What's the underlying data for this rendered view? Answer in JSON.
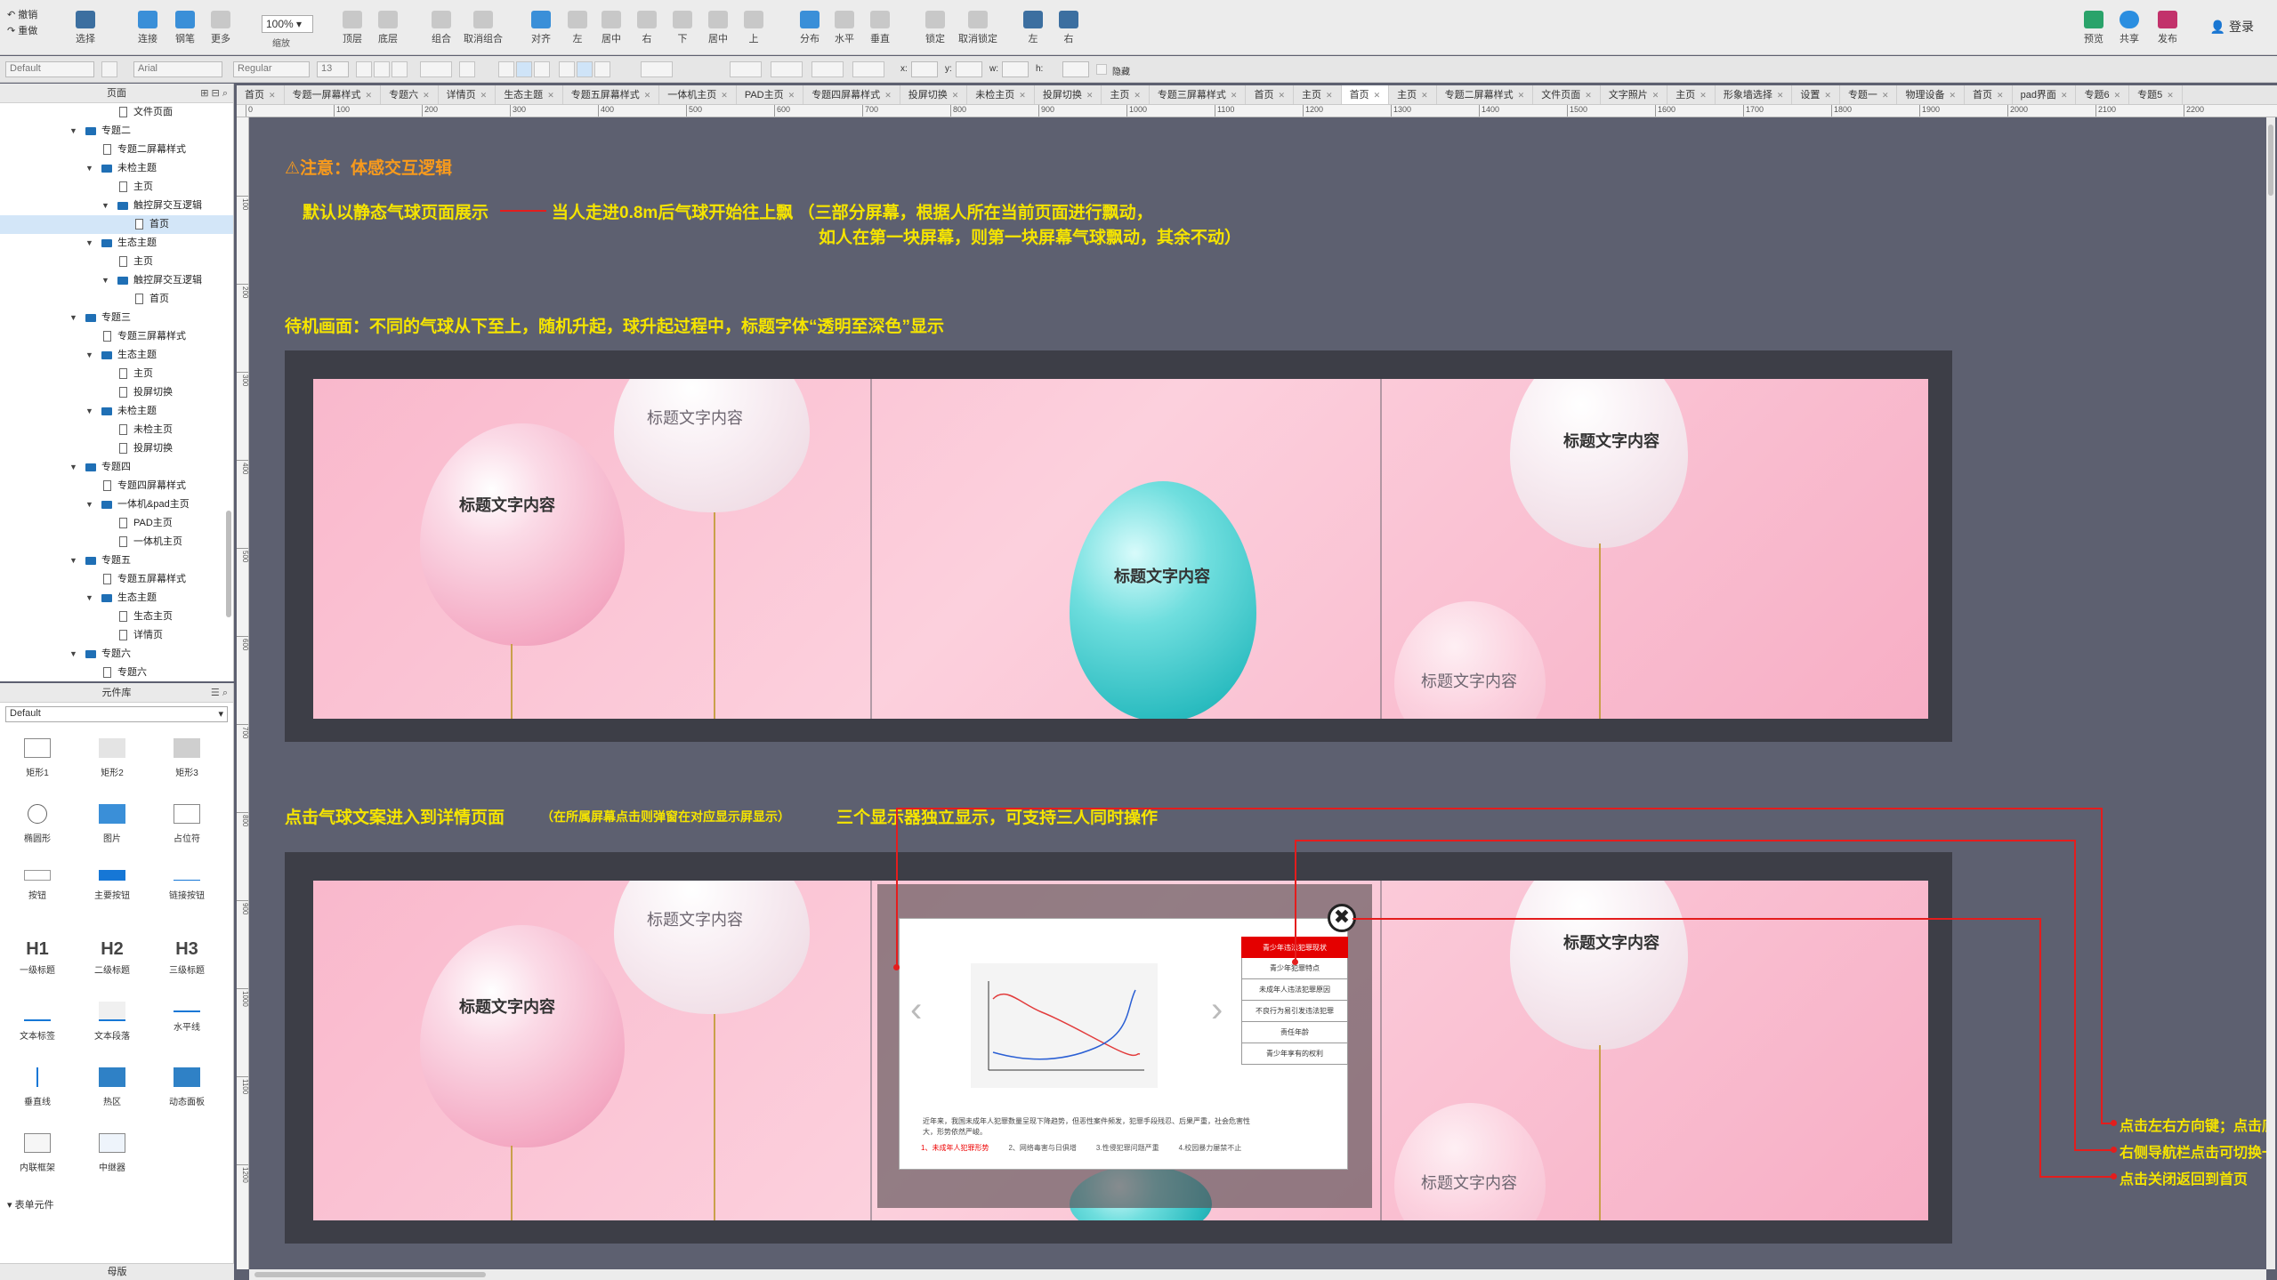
{
  "toolbar": {
    "undo": "撤销",
    "redo": "重做",
    "select": "选择",
    "connect": "连接",
    "pen": "钢笔",
    "more": "更多",
    "zoom_value": "100%",
    "zoom_label": "缩放",
    "top": "顶层",
    "bottom": "底层",
    "group": "组合",
    "ungroup": "取消组合",
    "align": "对齐",
    "left": "左",
    "center": "居中",
    "right": "右",
    "top2": "上",
    "middle": "居中",
    "bottom2": "下",
    "top3": "上",
    "distribute": "分布",
    "horizontal": "水平",
    "vertical": "垂直",
    "lock": "锁定",
    "unlock": "取消锁定",
    "left3": "左",
    "right3": "右",
    "preview": "预览",
    "share": "共享",
    "publish": "发布",
    "login": "登录"
  },
  "formatbar": {
    "style": "Default",
    "font": "Arial",
    "weight": "Regular",
    "size": "13",
    "x": "x:",
    "y": "y:",
    "w": "w:",
    "h": "h:",
    "hidden": "隐藏"
  },
  "pages_panel": {
    "title": "页面",
    "items": [
      {
        "label": "文件页面",
        "type": "page",
        "indent": 6
      },
      {
        "label": "专题二",
        "type": "folder",
        "indent": 2,
        "open": true
      },
      {
        "label": "专题二屏幕样式",
        "type": "page",
        "indent": 4
      },
      {
        "label": "未检主题",
        "type": "folder",
        "indent": 4,
        "open": true
      },
      {
        "label": "主页",
        "type": "page",
        "indent": 6
      },
      {
        "label": "触控屏交互逻辑",
        "type": "folder",
        "indent": 6,
        "open": true
      },
      {
        "label": "首页",
        "type": "page",
        "indent": 8,
        "selected": true
      },
      {
        "label": "生态主题",
        "type": "folder",
        "indent": 4,
        "open": true
      },
      {
        "label": "主页",
        "type": "page",
        "indent": 6
      },
      {
        "label": "触控屏交互逻辑",
        "type": "folder",
        "indent": 6,
        "open": true
      },
      {
        "label": "首页",
        "type": "page",
        "indent": 8
      },
      {
        "label": "专题三",
        "type": "folder",
        "indent": 2,
        "open": true
      },
      {
        "label": "专题三屏幕样式",
        "type": "page",
        "indent": 4
      },
      {
        "label": "生态主题",
        "type": "folder",
        "indent": 4,
        "open": true
      },
      {
        "label": "主页",
        "type": "page",
        "indent": 6
      },
      {
        "label": "投屏切换",
        "type": "page",
        "indent": 6
      },
      {
        "label": "未检主题",
        "type": "folder",
        "indent": 4,
        "open": true
      },
      {
        "label": "未检主页",
        "type": "page",
        "indent": 6
      },
      {
        "label": "投屏切换",
        "type": "page",
        "indent": 6
      },
      {
        "label": "专题四",
        "type": "folder",
        "indent": 2,
        "open": true
      },
      {
        "label": "专题四屏幕样式",
        "type": "page",
        "indent": 4
      },
      {
        "label": "一体机&pad主页",
        "type": "folder",
        "indent": 4,
        "open": true
      },
      {
        "label": "PAD主页",
        "type": "page",
        "indent": 6
      },
      {
        "label": "一体机主页",
        "type": "page",
        "indent": 6
      },
      {
        "label": "专题五",
        "type": "folder",
        "indent": 2,
        "open": true
      },
      {
        "label": "专题五屏幕样式",
        "type": "page",
        "indent": 4
      },
      {
        "label": "生态主题",
        "type": "folder",
        "indent": 4,
        "open": true
      },
      {
        "label": "生态主页",
        "type": "page",
        "indent": 6
      },
      {
        "label": "详情页",
        "type": "page",
        "indent": 6
      },
      {
        "label": "专题六",
        "type": "folder",
        "indent": 2,
        "open": true
      },
      {
        "label": "专题六",
        "type": "page",
        "indent": 4
      }
    ]
  },
  "library": {
    "title": "元件库",
    "selected": "Default",
    "items": [
      {
        "label": "矩形1",
        "icon": "rectangle-icon"
      },
      {
        "label": "矩形2",
        "icon": "rectangle-gray-icon"
      },
      {
        "label": "矩形3",
        "icon": "rectangle-dark-icon"
      },
      {
        "label": "椭圆形",
        "icon": "ellipse-icon"
      },
      {
        "label": "图片",
        "icon": "image-icon"
      },
      {
        "label": "占位符",
        "icon": "placeholder-icon"
      },
      {
        "label": "按钮",
        "icon": "button-icon"
      },
      {
        "label": "主要按钮",
        "icon": "primary-button-icon"
      },
      {
        "label": "链接按钮",
        "icon": "link-button-icon"
      },
      {
        "label": "一级标题",
        "icon": "h1-icon",
        "glyph": "H1"
      },
      {
        "label": "二级标题",
        "icon": "h2-icon",
        "glyph": "H2"
      },
      {
        "label": "三级标题",
        "icon": "h3-icon",
        "glyph": "H3"
      },
      {
        "label": "文本标签",
        "icon": "text-label-icon"
      },
      {
        "label": "文本段落",
        "icon": "paragraph-icon"
      },
      {
        "label": "水平线",
        "icon": "horizontal-line-icon"
      },
      {
        "label": "垂直线",
        "icon": "vertical-line-icon"
      },
      {
        "label": "热区",
        "icon": "hotspot-icon"
      },
      {
        "label": "动态面板",
        "icon": "dynamic-panel-icon"
      },
      {
        "label": "内联框架",
        "icon": "inline-frame-icon"
      },
      {
        "label": "中继器",
        "icon": "repeater-icon"
      }
    ],
    "section": "表单元件",
    "master": "母版"
  },
  "tabs": [
    "首页",
    "专题一屏幕样式",
    "专题六",
    "详情页",
    "生态主题",
    "专题五屏幕样式",
    "一体机主页",
    "PAD主页",
    "专题四屏幕样式",
    "投屏切换",
    "未检主页",
    "投屏切换",
    "主页",
    "专题三屏幕样式",
    "首页",
    "主页",
    "首页",
    "主页",
    "专题二屏幕样式",
    "文件页面",
    "文字照片",
    "主页",
    "形象墙选择",
    "设置",
    "专题一",
    "物理设备",
    "首页",
    "pad界面",
    "专题6",
    "专题5"
  ],
  "active_tab": 16,
  "ruler_h": [
    "0",
    "100",
    "200",
    "300",
    "400",
    "500",
    "600",
    "700",
    "800",
    "900",
    "1000",
    "1100",
    "1200",
    "1300",
    "1400",
    "1500",
    "1600",
    "1700",
    "1800",
    "1900",
    "2000",
    "2100",
    "2200"
  ],
  "ruler_v": [
    "100",
    "200",
    "300",
    "400",
    "500",
    "600",
    "700",
    "800",
    "900",
    "1000",
    "1100",
    "1200"
  ],
  "canvas": {
    "note_title": "⚠注意：体感交互逻辑",
    "note_default": "默认以静态气球页面展示",
    "note_approach": "当人走进0.8m后气球开始往上飘 （三部分屏幕，根据人所在当前页面进行飘动，",
    "note_approach2": "如人在第一块屏幕，则第一块屏幕气球飘动，其余不动）",
    "note_idle": "待机画面：不同的气球从下至上，随机升起，球升起过程中，标题字体“透明至深色”显示",
    "note_click": "点击气球文案进入到详情页面",
    "note_click_sub": "（在所属屏幕点击则弹窗在对应显示屏显示）",
    "note_three": "三个显示器独立显示，可支持三人同时操作",
    "balloon_title": "标题文字内容"
  },
  "modal": {
    "nav_items": [
      "青少年违法犯罪现状",
      "青少年犯罪特点",
      "未成年人违法犯罪原因",
      "不良行为易引发违法犯罪",
      "责任年龄",
      "青少年享有的权利"
    ],
    "paragraph": "近年来，我国未成年人犯罪数量呈现下降趋势，但恶性案件频发，犯罪手段残忍、后果严重，社会危害性大，形势依然严峻。",
    "bottom_tabs": [
      "1、未成年人犯罪形势",
      "2、网络毒害与日俱增",
      "3.性侵犯罪问题严重",
      "4.校园暴力屡禁不止"
    ],
    "close_glyph": "✖"
  },
  "annotations": [
    "点击左右方向键；点击底部标签，或滑动切换",
    "右侧导航栏点击可切换一级导航",
    "点击关闭返回到首页"
  ],
  "colors": {
    "accent_yellow": "#f5e400",
    "warning_orange": "#f89a1c",
    "annotation_red": "#e41d1d",
    "nav_active": "#e40000"
  }
}
